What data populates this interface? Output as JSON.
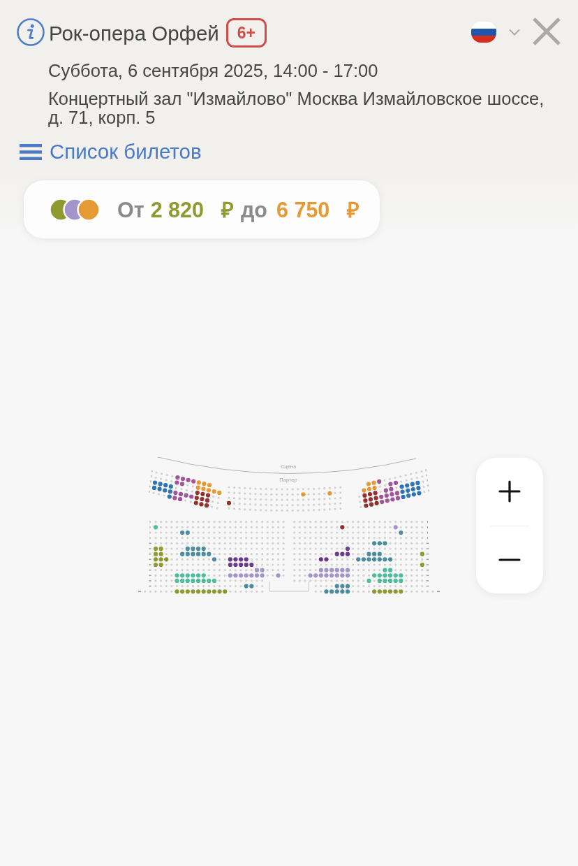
{
  "header": {
    "title": "Рок-опера Орфей",
    "age_rating": "6+",
    "date": "Суббота, 6 сентября 2025, 14:00 - 17:00",
    "venue": "Концертный зал \"Измайлово\" Москва Измайловское шоссе, д. 71, корп. 5",
    "ticket_list_link": "Список билетов"
  },
  "price_range": {
    "swatches": [
      {
        "color": "#8e9a2f"
      },
      {
        "color": "#a394c9"
      },
      {
        "color": "#e69a36"
      }
    ],
    "from_label": "От",
    "min_price": "2 820",
    "min_currency": "₽",
    "to_label": "до",
    "max_price": "6 750",
    "max_currency": "₽"
  },
  "seat_map": {
    "stage_label": "Сцена",
    "section_label": "Партер"
  }
}
